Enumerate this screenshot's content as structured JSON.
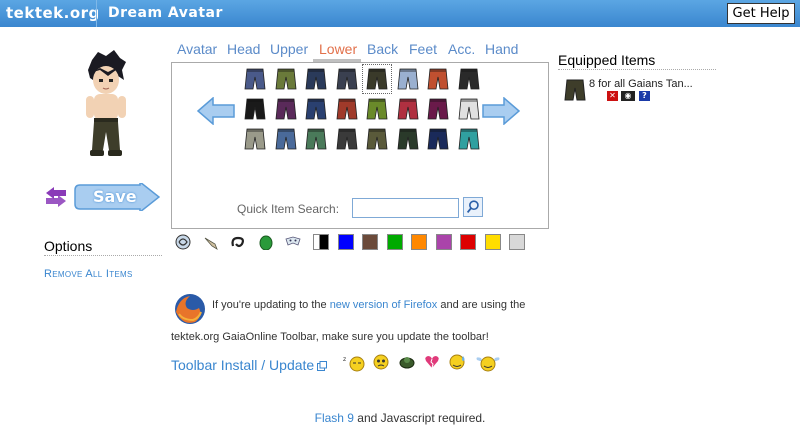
{
  "header": {
    "brand": "tektek.org",
    "app_title": "Dream Avatar",
    "help_label": "Get Help",
    "bar_color": "#3a86cf"
  },
  "left": {
    "save_label": "Save",
    "swap_icon": "swap-arrows-icon",
    "options_title": "Options",
    "remove_all_label": "Remove All Items"
  },
  "tabs": [
    {
      "label": "Avatar",
      "active": false
    },
    {
      "label": "Head",
      "active": false
    },
    {
      "label": "Upper",
      "active": false
    },
    {
      "label": "Lower",
      "active": true
    },
    {
      "label": "Back",
      "active": false
    },
    {
      "label": "Feet",
      "active": false
    },
    {
      "label": "Acc.",
      "active": false
    },
    {
      "label": "Hand",
      "active": false
    }
  ],
  "items": {
    "prev_icon": "arrow-left-icon",
    "next_icon": "arrow-right-icon",
    "rows": [
      [
        "#4a5a8a",
        "#6a7a3a",
        "#2a3a5a",
        "#3a4050",
        "#3a3a2a",
        "#9ab0d0",
        "#c05030",
        "#2a2a2a"
      ],
      [
        "#1a1a1a",
        "#5a2a5a",
        "#2a4070",
        "#a03a2a",
        "#6a8a2a",
        "#b03040",
        "#6a1a4a",
        "#e0e0e0"
      ],
      [
        "#9a9a8a",
        "#4a6a9a",
        "#4a7a5a",
        "#3a3a3a",
        "#5a5a3a",
        "#2a3a2a",
        "#1a2a5a",
        "#30a0a0"
      ]
    ],
    "selected": [
      0,
      4
    ],
    "quick_search_label": "Quick Item Search:",
    "quick_search_value": "",
    "search_icon": "magnifier-icon"
  },
  "swatches": {
    "icons": [
      "spiral-sphere-icon",
      "wing-icon",
      "knot-icon",
      "green-egg-icon",
      "mask-icon"
    ],
    "colors": [
      "#000000",
      "#0000ff",
      "#6b4a3a",
      "#00aa00",
      "#ff8800",
      "#aa44aa",
      "#dd0000",
      "#ffdd00",
      "#d8d8d8"
    ]
  },
  "equipped": {
    "title": "Equipped Items",
    "item_text": "8 for all Gaians Tan...",
    "controls": [
      "remove-icon",
      "view-icon",
      "help-icon"
    ]
  },
  "notice": {
    "text_before": "If you're updating to the ",
    "link_text": "new version of Firefox",
    "text_after": " and are using the",
    "line2": "tektek.org GaiaOnline Toolbar, make sure you update the toolbar!",
    "toolbar_link": "Toolbar Install / Update",
    "emotes": [
      "sleepy-face-icon",
      "worried-face-icon",
      "turtle-icon",
      "broken-heart-icon",
      "sweat-face-icon",
      "angel-face-icon"
    ]
  },
  "footer": {
    "flash_link": "Flash 9",
    "text": " and Javascript required."
  }
}
